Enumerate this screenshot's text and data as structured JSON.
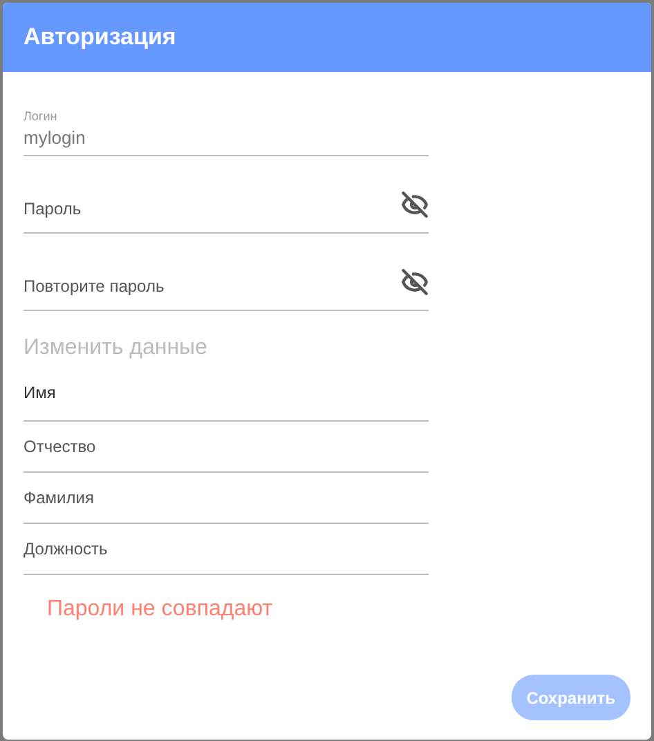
{
  "dialog": {
    "title": "Авторизация"
  },
  "fields": [
    {
      "kind": "text",
      "label": "Логин",
      "value": "mylogin"
    },
    {
      "kind": "password",
      "label": "Пароль",
      "visible": false
    },
    {
      "kind": "password",
      "label": "Повторите пароль",
      "visible": false
    }
  ],
  "section_title": "Изменить данные",
  "profile_fields": [
    {
      "label": "Имя"
    },
    {
      "label": "Отчество"
    },
    {
      "label": "Фамилия"
    },
    {
      "label": "Должность"
    }
  ],
  "error": "Пароли не совпадают",
  "save_button": {
    "label": "Сохранить",
    "disabled": true
  }
}
